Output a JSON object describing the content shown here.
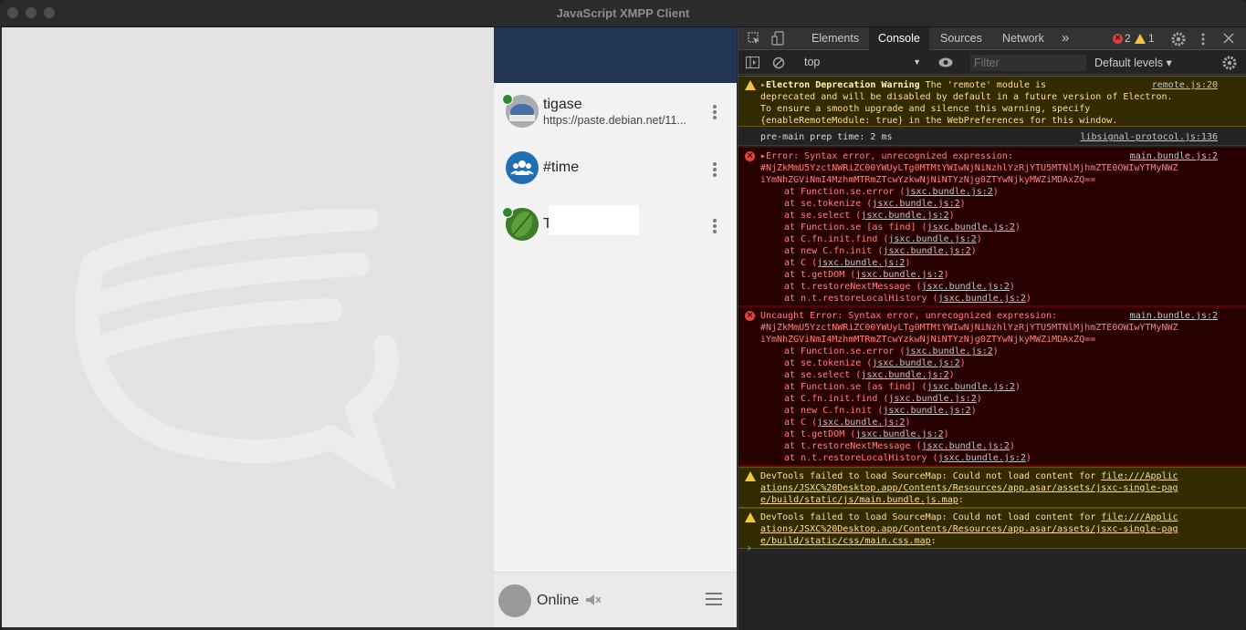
{
  "window": {
    "title": "JavaScript XMPP Client"
  },
  "roster": {
    "contacts": [
      {
        "name": "tigase",
        "subtitle": "https://paste.debian.net/11...",
        "status": "online",
        "avatar": "support-logo-avatar"
      },
      {
        "name": "#time",
        "subtitle": "",
        "status": "",
        "avatar": "group-icon"
      },
      {
        "name": "T",
        "subtitle": "",
        "status": "online",
        "avatar": "leaf-photo-avatar"
      }
    ],
    "footer": {
      "status_label": "Online"
    }
  },
  "devtools": {
    "tabs": [
      "Elements",
      "Console",
      "Sources",
      "Network"
    ],
    "active_tab": "Console",
    "more_tabs": "»",
    "error_count": "2",
    "warning_count": "1",
    "context": "top",
    "filter_placeholder": "Filter",
    "levels_label": "Default levels ▾",
    "messages": [
      {
        "type": "warn",
        "text_bold": "Electron Deprecation Warning",
        "text_line1": " The 'remote' module is",
        "text_rest": "deprecated and will be disabled by default in a future version of Electron.\nTo ensure a smooth upgrade and silence this warning, specify\n{enableRemoteModule: true} in the WebPreferences for this window.",
        "source": "remote.js:20"
      },
      {
        "type": "log",
        "text": "pre-main prep time: 2 ms",
        "source": "libsignal-protocol.js:136"
      },
      {
        "type": "err",
        "text": "▸Error: Syntax error, unrecognized expression:\n#NjZkMmU5YzctNWRiZC00YWUyLTg0MTMtYWIwNjNiNzhlYzRjYTU5MTNlMjhmZTE0OWIwYTMyNWZ\niYmNhZGViNmI4MzhmMTRmZTcwYzkwNjNiNTYzNjg0ZTYwNjkyMWZiMDAxZQ==",
        "source": "main.bundle.js:2",
        "stack": [
          [
            "at Function.se.error (",
            "jsxc.bundle.js:2",
            ")"
          ],
          [
            "at se.tokenize (",
            "jsxc.bundle.js:2",
            ")"
          ],
          [
            "at se.select (",
            "jsxc.bundle.js:2",
            ")"
          ],
          [
            "at Function.se [as find] (",
            "jsxc.bundle.js:2",
            ")"
          ],
          [
            "at C.fn.init.find (",
            "jsxc.bundle.js:2",
            ")"
          ],
          [
            "at new C.fn.init (",
            "jsxc.bundle.js:2",
            ")"
          ],
          [
            "at C (",
            "jsxc.bundle.js:2",
            ")"
          ],
          [
            "at t.getDOM (",
            "jsxc.bundle.js:2",
            ")"
          ],
          [
            "at t.restoreNextMessage (",
            "jsxc.bundle.js:2",
            ")"
          ],
          [
            "at n.t.restoreLocalHistory (",
            "jsxc.bundle.js:2",
            ")"
          ]
        ]
      },
      {
        "type": "err",
        "text": "Uncaught Error: Syntax error, unrecognized expression:\n#NjZkMmU5YzctNWRiZC00YWUyLTg0MTMtYWIwNjNiNzhlYzRjYTU5MTNlMjhmZTE0OWIwYTMyNWZ\niYmNhZGViNmI4MzhmMTRmZTcwYzkwNjNiNTYzNjg0ZTYwNjkyMWZiMDAxZQ==",
        "source": "main.bundle.js:2",
        "stack": [
          [
            "at Function.se.error (",
            "jsxc.bundle.js:2",
            ")"
          ],
          [
            "at se.tokenize (",
            "jsxc.bundle.js:2",
            ")"
          ],
          [
            "at se.select (",
            "jsxc.bundle.js:2",
            ")"
          ],
          [
            "at Function.se [as find] (",
            "jsxc.bundle.js:2",
            ")"
          ],
          [
            "at C.fn.init.find (",
            "jsxc.bundle.js:2",
            ")"
          ],
          [
            "at new C.fn.init (",
            "jsxc.bundle.js:2",
            ")"
          ],
          [
            "at C (",
            "jsxc.bundle.js:2",
            ")"
          ],
          [
            "at t.getDOM (",
            "jsxc.bundle.js:2",
            ")"
          ],
          [
            "at t.restoreNextMessage (",
            "jsxc.bundle.js:2",
            ")"
          ],
          [
            "at n.t.restoreLocalHistory (",
            "jsxc.bundle.js:2",
            ")"
          ]
        ]
      },
      {
        "type": "warn",
        "text_plain": "DevTools failed to load SourceMap: Could not load content for ",
        "link": "file:///Applic\nations/JSXC%20Desktop.app/Contents/Resources/app.asar/assets/jsxc-single-pag\ne/build/static/js/main.bundle.js.map",
        "suffix": ":"
      },
      {
        "type": "warn",
        "text_plain": "DevTools failed to load SourceMap: Could not load content for ",
        "link": "file:///Applic\nations/JSXC%20Desktop.app/Contents/Resources/app.asar/assets/jsxc-single-pag\ne/build/static/css/main.css.map",
        "suffix": ":"
      }
    ],
    "prompt": "›"
  },
  "colors": {
    "roster_header": "#233554",
    "presence_online": "#2a8a2a",
    "group_avatar": "#1f6fb2",
    "error_bg": "#290000",
    "warning_bg": "#332b00"
  }
}
